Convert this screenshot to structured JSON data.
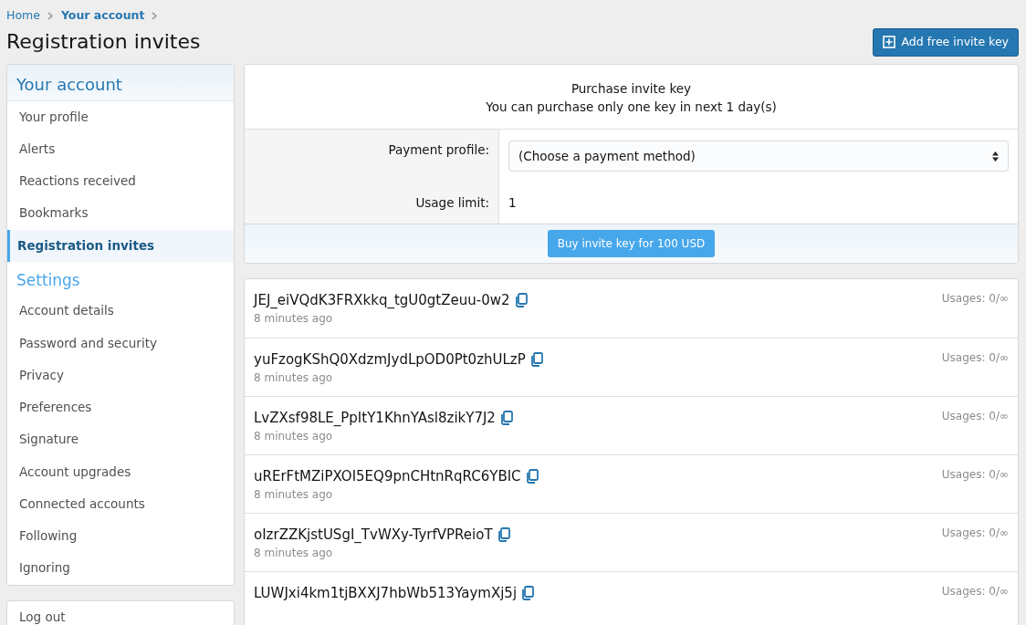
{
  "breadcrumb": [
    {
      "label": "Home",
      "current": false
    },
    {
      "label": "Your account",
      "current": true
    }
  ],
  "page_title": "Registration invites",
  "add_button": {
    "label": "Add free invite key"
  },
  "sidebar": {
    "sections": [
      {
        "title": "Your account",
        "kind": "header",
        "items": [
          {
            "label": "Your profile",
            "selected": false
          },
          {
            "label": "Alerts",
            "selected": false
          },
          {
            "label": "Reactions received",
            "selected": false
          },
          {
            "label": "Bookmarks",
            "selected": false
          },
          {
            "label": "Registration invites",
            "selected": true
          }
        ]
      },
      {
        "title": "Settings",
        "kind": "subheader",
        "items": [
          {
            "label": "Account details",
            "selected": false
          },
          {
            "label": "Password and security",
            "selected": false
          },
          {
            "label": "Privacy",
            "selected": false
          },
          {
            "label": "Preferences",
            "selected": false
          },
          {
            "label": "Signature",
            "selected": false
          },
          {
            "label": "Account upgrades",
            "selected": false
          },
          {
            "label": "Connected accounts",
            "selected": false
          },
          {
            "label": "Following",
            "selected": false
          },
          {
            "label": "Ignoring",
            "selected": false
          }
        ]
      }
    ],
    "logout": "Log out"
  },
  "purchase": {
    "title": "Purchase invite key",
    "subtitle": "You can purchase only one key in next 1 day(s)",
    "fields": [
      {
        "label": "Payment profile:",
        "kind": "select",
        "value": "(Choose a payment method)"
      },
      {
        "label": "Usage limit:",
        "kind": "text",
        "value": "1"
      }
    ],
    "button": "Buy invite key for 100 USD"
  },
  "keys": [
    {
      "key": "JEJ_eiVQdK3FRXkkq_tgU0gtZeuu-0w2",
      "time": "8 minutes ago",
      "usages": "Usages: 0/∞"
    },
    {
      "key": "yuFzogKShQ0XdzmJydLpOD0Pt0zhULzP",
      "time": "8 minutes ago",
      "usages": "Usages: 0/∞"
    },
    {
      "key": "LvZXsf98LE_PpItY1KhnYAsl8zikY7J2",
      "time": "8 minutes ago",
      "usages": "Usages: 0/∞"
    },
    {
      "key": "uRErFtMZiPXOI5EQ9pnCHtnRqRC6YBIC",
      "time": "8 minutes ago",
      "usages": "Usages: 0/∞"
    },
    {
      "key": "oIzrZZKjstUSgI_TvWXy-TyrfVPReioT",
      "time": "8 minutes ago",
      "usages": "Usages: 0/∞"
    },
    {
      "key": "LUWJxi4km1tjBXXJ7hbWb513YaymXj5j",
      "usages": "Usages: 0/∞"
    }
  ]
}
